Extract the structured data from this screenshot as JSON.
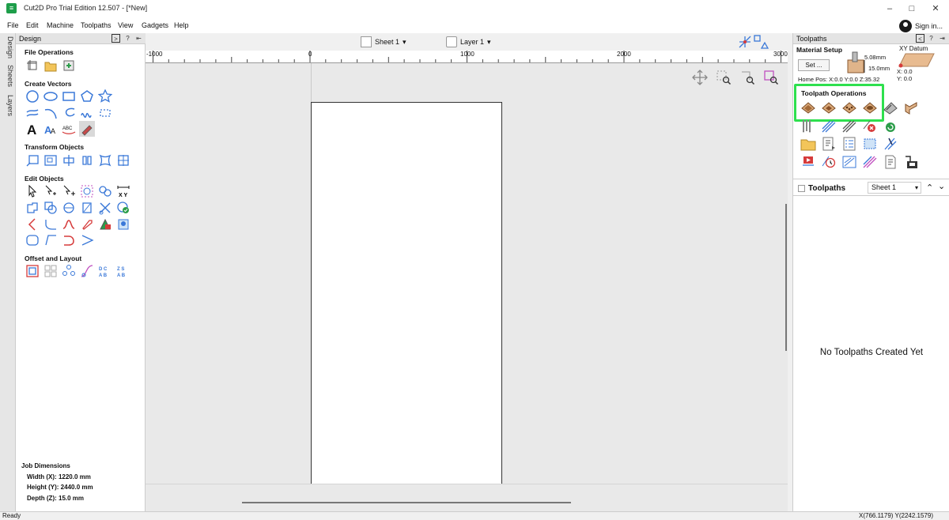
{
  "window": {
    "title": "Cut2D Pro Trial Edition 12.507 - [*New]",
    "controls": [
      "–",
      "□",
      "✕"
    ]
  },
  "menu": [
    "File",
    "Edit",
    "Machine",
    "Toolpaths",
    "View",
    "Gadgets",
    "Help"
  ],
  "account": {
    "label": "Sign in..."
  },
  "side_tabs": [
    "Design",
    "Sheets",
    "Layers"
  ],
  "design_panel": {
    "title": "Design",
    "sections": [
      "File Operations",
      "Create Vectors",
      "Transform Objects",
      "Edit Objects",
      "Offset and Layout"
    ]
  },
  "job_dimensions": {
    "title": "Job Dimensions",
    "width_label": "Width  (X):",
    "width": "1220.0 mm",
    "height_label": "Height (Y):",
    "height": "2440.0 mm",
    "depth_label": "Depth  (Z):",
    "depth": "15.0 mm"
  },
  "view_toolbar": {
    "sheet": "Sheet 1",
    "layer": "Layer 1"
  },
  "ruler": {
    "labels": [
      "-1000",
      "0",
      "1000",
      "2000",
      "3000"
    ]
  },
  "toolpaths_panel": {
    "title": "Toolpaths",
    "material_setup": "Material Setup",
    "set_button": "Set ...",
    "thickness_top": "5.08mm",
    "thickness_total": "15.0mm",
    "home_pos": "Home Pos:  X:0.0 Y:0.0 Z:35.32",
    "xy_datum": "XY Datum",
    "datum_x": "X: 0.0",
    "datum_y": "Y: 0.0",
    "operations_title": "Toolpath Operations",
    "list_title": "Toolpaths",
    "list_sheet": "Sheet 1",
    "empty_message": "No Toolpaths Created Yet"
  },
  "status": {
    "text": "Ready",
    "coords": "X(766.1179) Y(2242.1579)"
  },
  "colors": {
    "highlight": "#2ee04e",
    "icon_blue": "#3a78d8",
    "icon_red": "#d63b3b"
  }
}
